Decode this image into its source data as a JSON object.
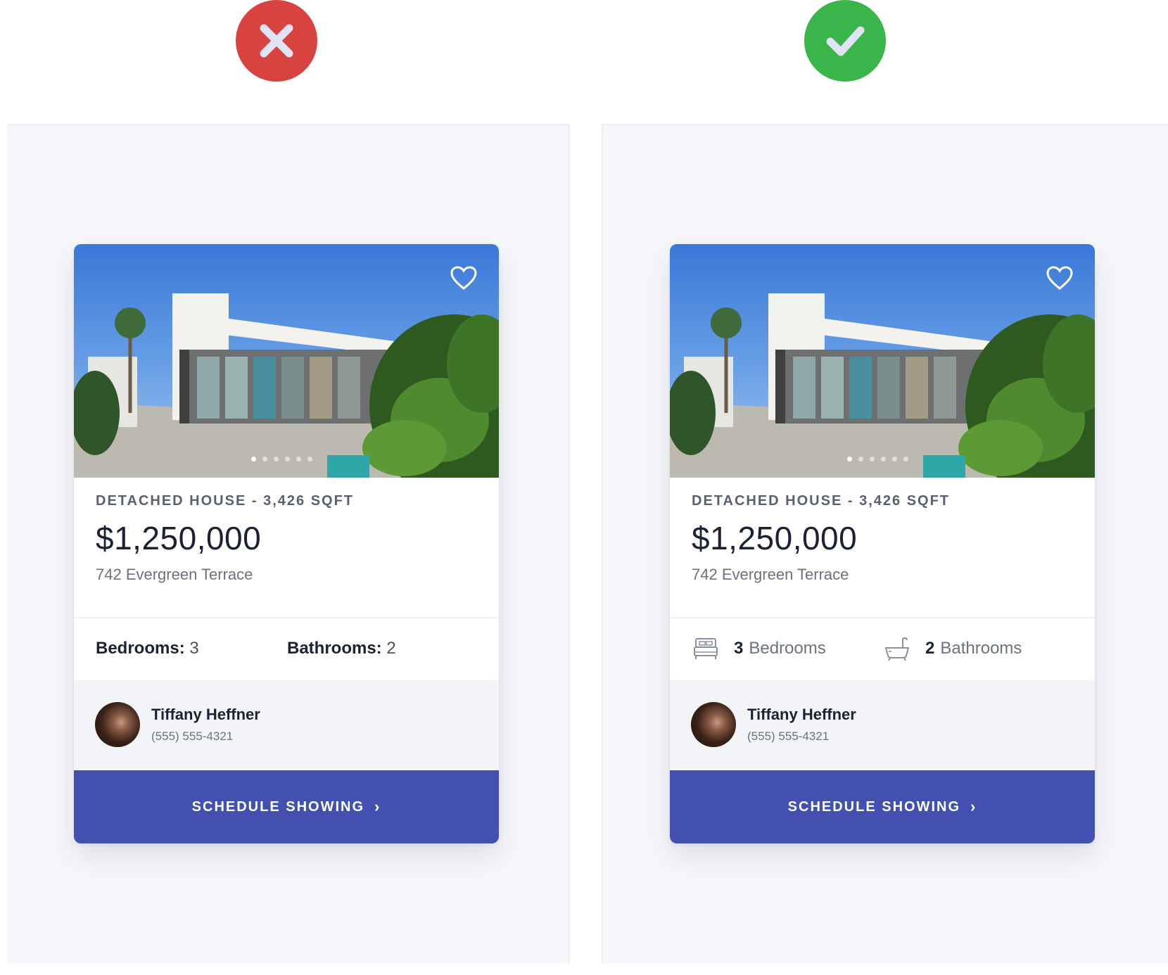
{
  "badges": {
    "bad": {
      "icon": "x-mark-icon",
      "color": "#d84340"
    },
    "good": {
      "icon": "checkmark-icon",
      "color": "#3ab54a"
    }
  },
  "cards": {
    "left": {
      "property_type": "DETACHED HOUSE - 3,426 SQFT",
      "price": "$1,250,000",
      "address": "742 Evergreen Terrace",
      "bedrooms_label": "Bedrooms:",
      "bedrooms_value": "3",
      "bathrooms_label": "Bathrooms:",
      "bathrooms_value": "2",
      "agent_name": "Tiffany Heffner",
      "agent_phone": "(555) 555-4321",
      "cta_label": "SCHEDULE SHOWING",
      "cta_icon": "chevron-right-icon"
    },
    "right": {
      "property_type": "DETACHED HOUSE - 3,426 SQFT",
      "price": "$1,250,000",
      "address": "742 Evergreen Terrace",
      "bedrooms_value": "3",
      "bedrooms_label": "Bedrooms",
      "bedrooms_icon": "bed-icon",
      "bathrooms_value": "2",
      "bathrooms_label": "Bathrooms",
      "bathrooms_icon": "bathtub-icon",
      "agent_name": "Tiffany Heffner",
      "agent_phone": "(555) 555-4321",
      "cta_label": "SCHEDULE SHOWING",
      "cta_icon": "chevron-right-icon"
    }
  },
  "colors": {
    "cta": "#4350b0",
    "panel": "#f6f7fa",
    "agent_bg": "#f2f4f8"
  },
  "carousel": {
    "count": 6,
    "active": 1
  }
}
